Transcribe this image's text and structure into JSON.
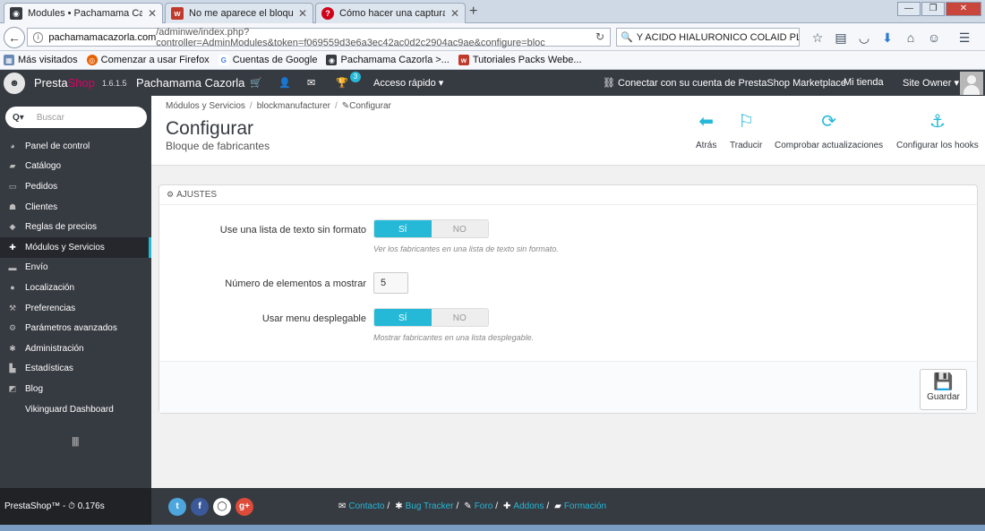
{
  "browser": {
    "tabs": [
      {
        "title": "Modules • Pachamama Ca...",
        "active": true,
        "icon": "prestashop-favicon"
      },
      {
        "title": "No me aparece el bloque d...",
        "active": false,
        "icon": "webempresa-favicon"
      },
      {
        "title": "Cómo hacer una captura d...",
        "active": false,
        "icon": "help-favicon"
      }
    ],
    "url_host": "pachamamacazorla.com",
    "url_path": "/adminwe/index.php?controller=AdminModules&token=f069559d3e6a3ec42ac0d2c2904ac9ae&configure=bloc",
    "search_value": "Y ACIDO HIALURONICO COLAID PLUS",
    "bookmarks": [
      {
        "label": "Más visitados",
        "icon": "bookmark-folder-icon"
      },
      {
        "label": "Comenzar a usar Firefox",
        "icon": "firefox-icon"
      },
      {
        "label": "Cuentas de Google",
        "icon": "google-icon"
      },
      {
        "label": "Pachamama Cazorla >...",
        "icon": "prestashop-favicon"
      },
      {
        "label": "Tutoriales Packs Webe...",
        "icon": "webempresa-favicon"
      }
    ]
  },
  "header": {
    "brand_presta": "Presta",
    "brand_shop": "Shop",
    "version": "1.6.1.5",
    "store_name": "Pachamama Cazorla",
    "notification_count": "3",
    "quick_access": "Acceso rápido",
    "marketplace": "Conectar con su cuenta de PrestaShop Marketplace",
    "my_shop": "Mi tienda",
    "user_role": "Site Owner"
  },
  "sidebar": {
    "search_placeholder": "Buscar",
    "items": [
      {
        "label": "Panel de control",
        "icon": "dashboard-icon"
      },
      {
        "label": "Catálogo",
        "icon": "book-icon"
      },
      {
        "label": "Pedidos",
        "icon": "credit-card-icon"
      },
      {
        "label": "Clientes",
        "icon": "users-icon"
      },
      {
        "label": "Reglas de precios",
        "icon": "tag-icon"
      },
      {
        "label": "Módulos y Servicios",
        "icon": "puzzle-icon",
        "active": true
      },
      {
        "label": "Envío",
        "icon": "truck-icon"
      },
      {
        "label": "Localización",
        "icon": "globe-icon"
      },
      {
        "label": "Preferencias",
        "icon": "wrench-icon"
      },
      {
        "label": "Parámetros avanzados",
        "icon": "cogs-icon"
      },
      {
        "label": "Administración",
        "icon": "cog-icon"
      },
      {
        "label": "Estadísticas",
        "icon": "bar-chart-icon"
      },
      {
        "label": "Blog",
        "icon": "edit-icon"
      },
      {
        "label": "Vikinguard Dashboard",
        "icon": ""
      }
    ]
  },
  "page": {
    "breadcrumb": [
      "Módulos y Servicios",
      "blockmanufacturer",
      "Configurar"
    ],
    "title": "Configurar",
    "subtitle": "Bloque de fabricantes",
    "actions": [
      {
        "label": "Atrás",
        "icon": "arrow-circle-left-icon"
      },
      {
        "label": "Traducir",
        "icon": "flag-icon"
      },
      {
        "label": "Comprobar actualizaciones",
        "icon": "refresh-icon"
      },
      {
        "label": "Configurar los hooks",
        "icon": "anchor-icon"
      }
    ]
  },
  "panel": {
    "heading": "Ajustes",
    "fields": [
      {
        "label": "Use una lista de texto sin formato",
        "on": "SÍ",
        "off": "NO",
        "help": "Ver los fabricantes en una lista de texto sin formato."
      },
      {
        "label": "Número de elementos a mostrar",
        "value": "5"
      },
      {
        "label": "Usar menu desplegable",
        "on": "SÍ",
        "off": "NO",
        "help": "Mostrar fabricantes en una lista desplegable."
      }
    ],
    "save_label": "Guardar"
  },
  "footer": {
    "version_text": "PrestaShop™ - ⏱ 0.176s",
    "links": [
      "Contacto",
      "Bug Tracker",
      "Foro",
      "Addons",
      "Formación"
    ]
  },
  "colors": {
    "accent": "#25b9d7",
    "dark": "#363a41",
    "brand_pink": "#df0067"
  }
}
